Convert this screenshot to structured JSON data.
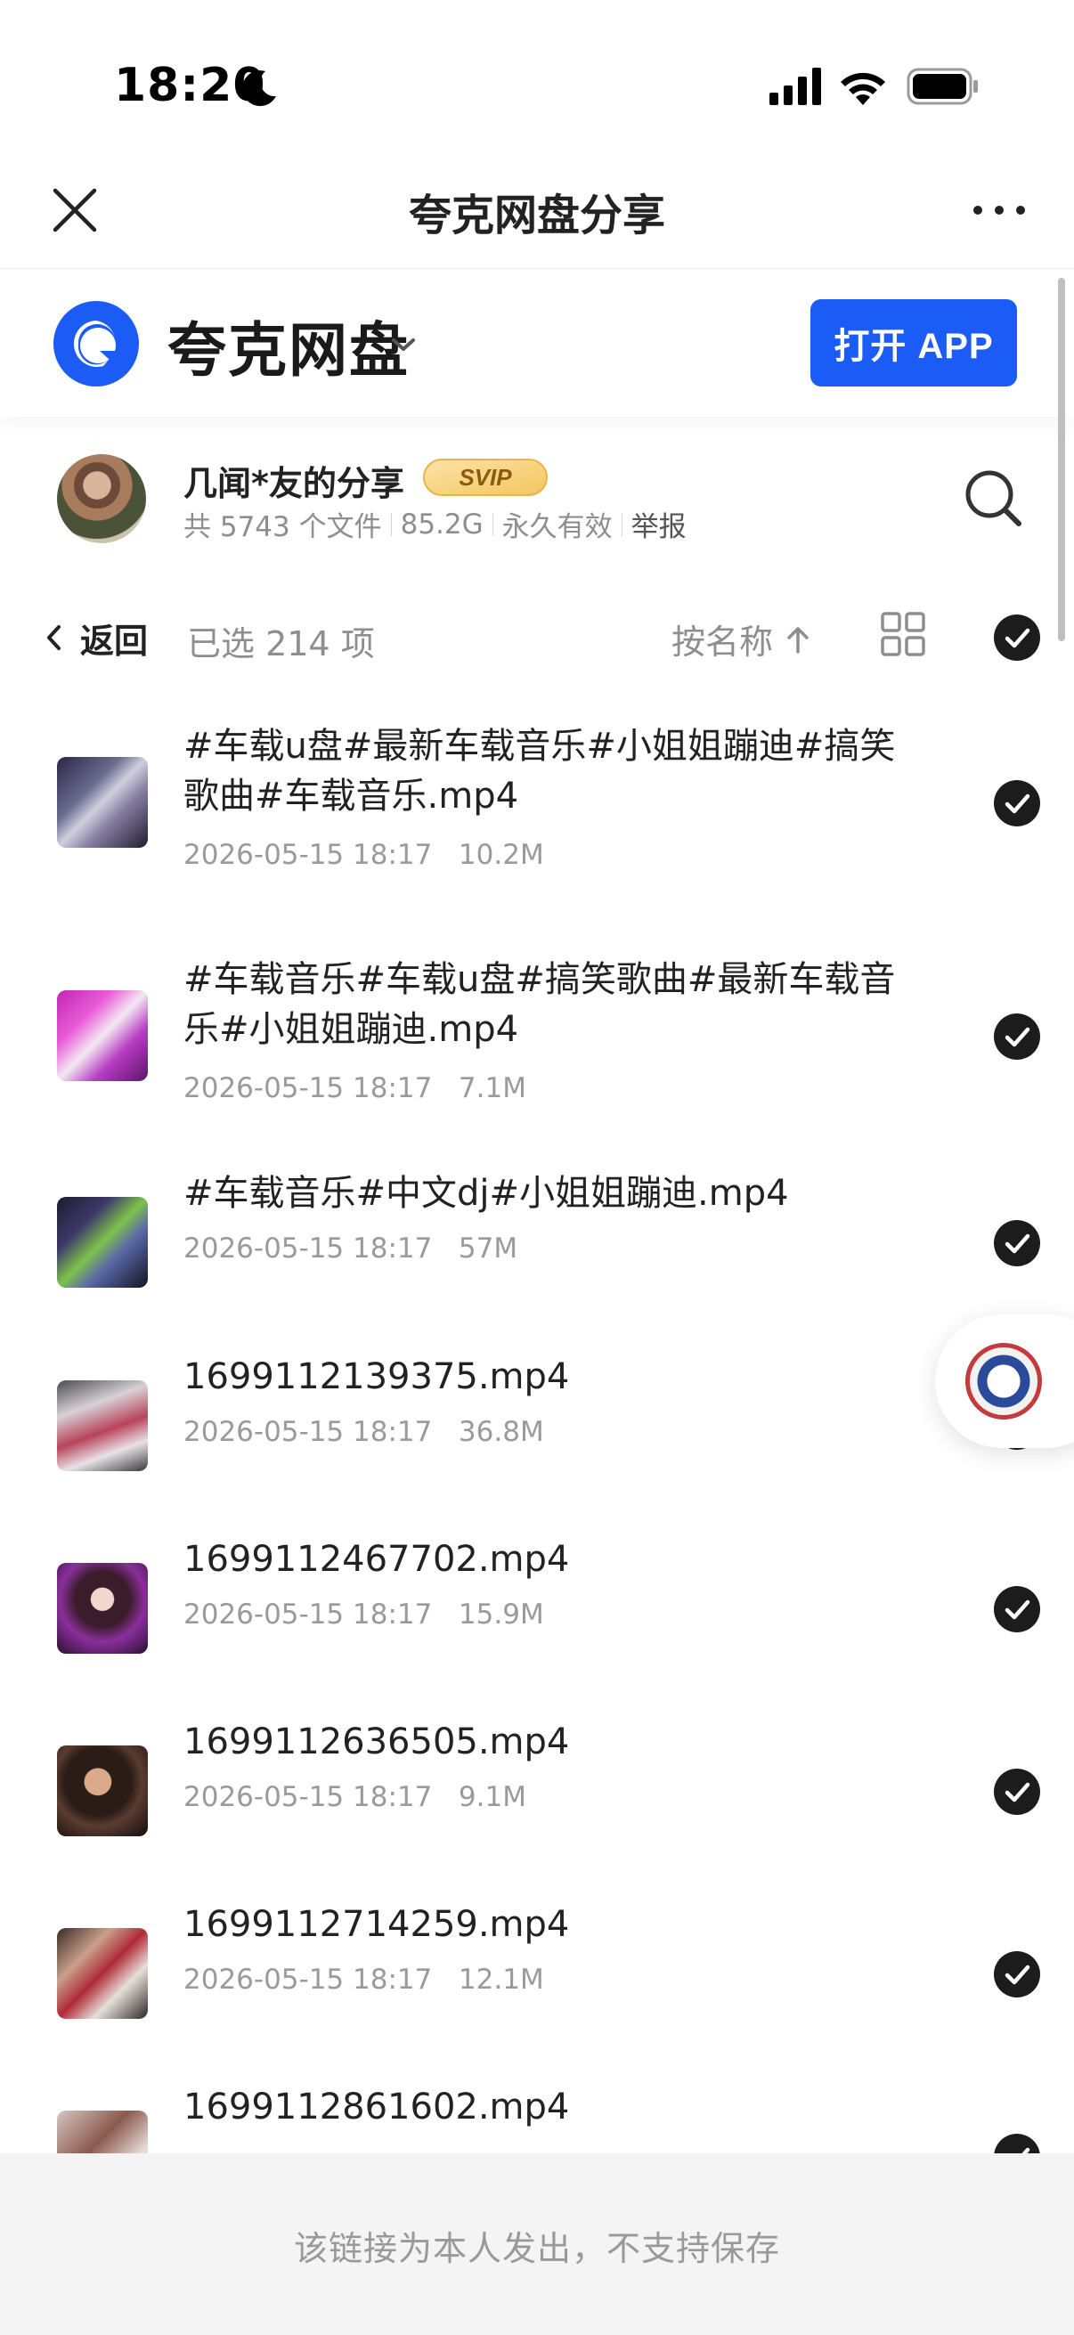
{
  "status_bar": {
    "time": "18:20"
  },
  "nav": {
    "title": "夸克网盘分享"
  },
  "brand": {
    "name": "夸克网盘",
    "open_app_label": "打开 APP",
    "accent": "#1a5cf5"
  },
  "sharer": {
    "name": "几闻*友的分享",
    "badge": "SVIP",
    "file_count": "共 5743 个文件",
    "total_size": "85.2G",
    "validity": "永久有效",
    "report_label": "举报"
  },
  "toolbar": {
    "back_label": "返回",
    "selected_count": "已选 214 项",
    "sort_label": "按名称"
  },
  "files": [
    {
      "name": "#车载u盘#最新车载音乐#小姐姐蹦迪#搞笑歌曲#车载音乐.mp4",
      "date": "2026-05-15 18:17",
      "size": "10.2M",
      "selected": true
    },
    {
      "name": "#车载音乐#车载u盘#搞笑歌曲#最新车载音乐#小姐姐蹦迪.mp4",
      "date": "2026-05-15 18:17",
      "size": "7.1M",
      "selected": true
    },
    {
      "name": "#车载音乐#中文dj#小姐姐蹦迪.mp4",
      "date": "2026-05-15 18:17",
      "size": "57M",
      "selected": true
    },
    {
      "name": "1699112139375.mp4",
      "date": "2026-05-15 18:17",
      "size": "36.8M",
      "selected": true
    },
    {
      "name": "1699112467702.mp4",
      "date": "2026-05-15 18:17",
      "size": "15.9M",
      "selected": true
    },
    {
      "name": "1699112636505.mp4",
      "date": "2026-05-15 18:17",
      "size": "9.1M",
      "selected": true
    },
    {
      "name": "1699112714259.mp4",
      "date": "2026-05-15 18:17",
      "size": "12.1M",
      "selected": true
    },
    {
      "name": "1699112861602.mp4",
      "date": "",
      "size": "",
      "selected": true
    }
  ],
  "footer": {
    "notice": "该链接为本人发出，不支持保存"
  },
  "icons": {
    "close": "close-icon",
    "more": "more-icon",
    "logo": "quark-logo-icon",
    "search": "search-icon",
    "grid": "grid-view-icon",
    "check": "check-circle-icon"
  }
}
